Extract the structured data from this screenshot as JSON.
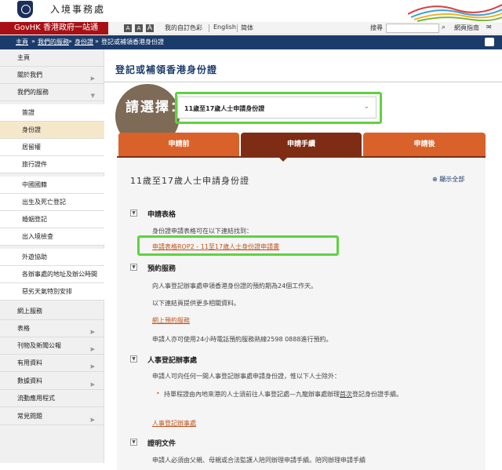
{
  "header": {
    "dept_name": "入境事務處"
  },
  "govbar": {
    "govhk": "GovHK 香港政府一站通",
    "font_small": "A",
    "font_med": "A",
    "font_large": "A",
    "colour": "我的自訂色彩",
    "english": "English",
    "simplified": "简体",
    "search_label": "搜尋",
    "site_map": "網頁指南"
  },
  "breadcrumb": {
    "home": "主頁",
    "services": "我們的服務",
    "id_card": "身份證",
    "current": "登記或補領香港身份證"
  },
  "sidebar": {
    "items": [
      {
        "label": "主頁"
      },
      {
        "label": "關於我們"
      },
      {
        "label": "我們的服務"
      },
      {
        "label": "簽證"
      },
      {
        "label": "身份證"
      },
      {
        "label": "居留權"
      },
      {
        "label": "旅行證件"
      },
      {
        "label": "中國國籍"
      },
      {
        "label": "出生及死亡登記"
      },
      {
        "label": "婚姻登記"
      },
      {
        "label": "出入境檢查"
      },
      {
        "label": "外遊協助"
      },
      {
        "label": "各辦事處的地址及辦公時間"
      },
      {
        "label": "惡劣天氣特別安排"
      },
      {
        "label": "網上服務"
      },
      {
        "label": "表格"
      },
      {
        "label": "刊物及新聞公報"
      },
      {
        "label": "有用資料"
      },
      {
        "label": "數據資料"
      },
      {
        "label": "流動應用程式"
      },
      {
        "label": "常見問題"
      }
    ]
  },
  "main": {
    "title": "登記或補領香港身份證",
    "pick_label": "請選擇：",
    "selected": "11歲至17歲人士申請身份證",
    "tabs": [
      {
        "label": "申請前"
      },
      {
        "label": "申請手續"
      },
      {
        "label": "申請後"
      }
    ],
    "section_title": "11歲至17歲人士申請身份證",
    "expand_all": "⊕ 顯示全部",
    "sec1": {
      "head": "申請表格",
      "text": "身份證申請表格可在以下連結找到：",
      "link": "申請表格ROP2 - 11至17歲人士身份證申請書"
    },
    "sec2": {
      "head": "預約服務",
      "t1": "向人事登記辦事處申領香港身份證的預約期為24個工作天。",
      "t2": "以下連結頁提供更多相關資料。",
      "link": "網上預約服務",
      "t3": "申請人亦可使用24小時電話預約服務熱線2598 0888進行預約。"
    },
    "sec3": {
      "head": "人事登記辦事處",
      "t1": "申請人可向任何一間人事登記辦事處申請身份證，惟以下人士除外：",
      "b1a": "持單程證由內地來港的人士須前往人事登記處—九龍辦事處辦理",
      "b1u": "首次",
      "b1b": "登記身份證手續。",
      "link": "人事登記辦事處"
    },
    "sec4": {
      "head": "證明文件",
      "t1": "申請人必須由父親、母親或合法監護人陪同辦理申請手續。陪同辦理申請手續"
    }
  }
}
